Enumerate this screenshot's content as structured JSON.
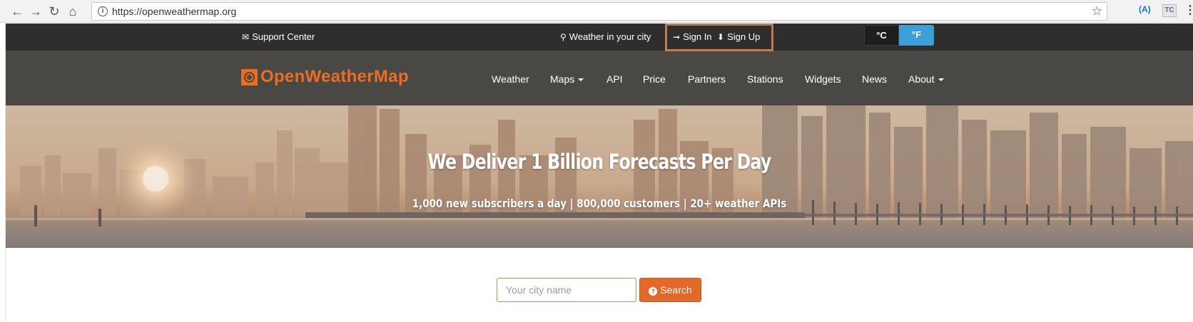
{
  "browser": {
    "url": "https://openweathermap.org",
    "back_icon": "back-arrow",
    "forward_icon": "forward-arrow",
    "reload_icon": "reload",
    "home_icon": "home",
    "extension_a": "(A)",
    "extension_tc": "TC"
  },
  "topbar": {
    "support_label": "Support Center",
    "weather_city_label": "Weather in your city",
    "signin_label": "Sign In",
    "signup_label": "Sign Up",
    "unit_c": "°C",
    "unit_f": "°F",
    "active_unit": "°F",
    "highlight_color": "#c07a4b"
  },
  "nav": {
    "logo_text": "OpenWeatherMap",
    "items": [
      {
        "label": "Weather"
      },
      {
        "label": "Maps",
        "dropdown": true
      },
      {
        "label": "API"
      },
      {
        "label": "Price"
      },
      {
        "label": "Partners"
      },
      {
        "label": "Stations"
      },
      {
        "label": "Widgets"
      },
      {
        "label": "News"
      },
      {
        "label": "About",
        "dropdown": true
      }
    ],
    "brand_color": "#eb6e1f"
  },
  "hero": {
    "title": "We Deliver 1 Billion Forecasts Per Day",
    "subtitle": "1,000 new subscribers a day | 800,000 customers | 20+ weather APIs"
  },
  "search": {
    "placeholder": "Your city name",
    "button_label": "Search",
    "button_color": "#e2692a"
  }
}
